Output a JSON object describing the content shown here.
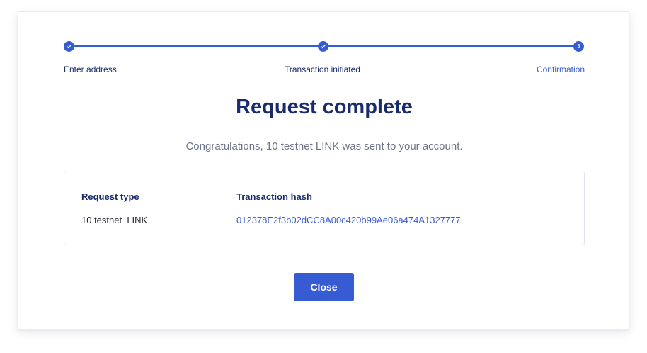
{
  "stepper": {
    "steps": [
      {
        "label": "Enter address",
        "state": "complete",
        "icon": "check-icon"
      },
      {
        "label": "Transaction initiated",
        "state": "complete",
        "icon": "check-icon"
      },
      {
        "label": "Confirmation",
        "state": "current",
        "number": "3"
      }
    ]
  },
  "title": "Request complete",
  "subtitle": "Congratulations, 10 testnet LINK was sent to your account.",
  "details": {
    "request_type_header": "Request type",
    "request_type_value": "10 testnet  LINK",
    "tx_hash_header": "Transaction hash",
    "tx_hash_value": "012378E2f3b02dCC8A00c420b99Ae06a474A1327777"
  },
  "close_label": "Close",
  "colors": {
    "accent": "#375bd2",
    "heading": "#1a2b6b",
    "muted": "#6c7588"
  }
}
